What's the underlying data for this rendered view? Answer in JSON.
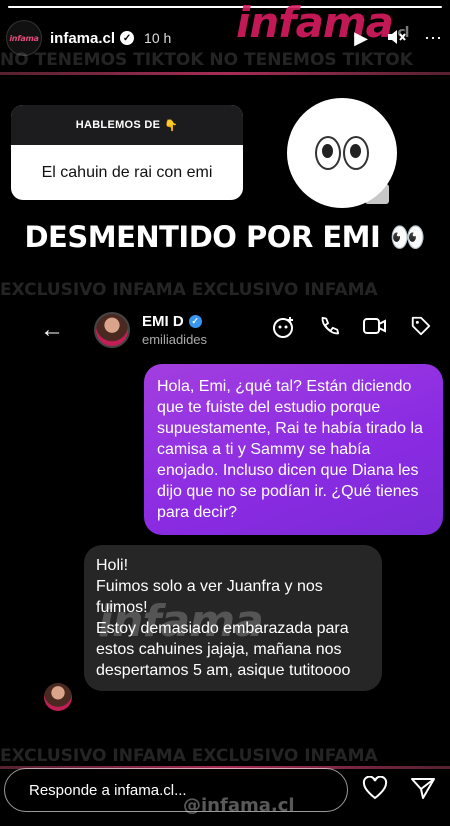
{
  "story": {
    "progress_fraction": 1.0,
    "username": "infama.cl",
    "time": "10 h",
    "avatar_text": "infama",
    "brand_watermark": "infama",
    "brand_suffix": ".cl",
    "banner_top": "NO TENEMOS TIKTOK NO TENEMOS TIKTOK",
    "banner_mid": "EXCLUSIVO INFAMA EXCLUSIVO INFAMA",
    "banner_bottom": "EXCLUSIVO INFAMA EXCLUSIVO INFAMA",
    "handle_watermark": "@infama.cl"
  },
  "question": {
    "title": "HABLEMOS DE",
    "emoji": "👇",
    "answer": "El cahuin de rai con emi"
  },
  "headline": "DESMENTIDO POR EMI 👀",
  "dm": {
    "name": "EMI D",
    "handle": "emiliadides",
    "outgoing": "Hola, Emi, ¿qué tal? Están diciendo que te fuiste del estudio porque supuestamente, Rai te había tirado la camisa a ti y Sammy se había enojado. Incluso dicen que Diana les dijo que no se podían ir. ¿Qué tienes para decir?",
    "incoming": [
      "Holi!",
      "Fuimos solo a ver Juanfra y nos fuimos!",
      "Estoy demasiado embarazada para estos cahuines jajaja, mañana nos despertamos 5 am, asique tutitoooo"
    ]
  },
  "reply": {
    "placeholder": "Responde a infama.cl..."
  },
  "icons": {
    "back": "arrow-left-icon",
    "video_add": "video-effects-icon",
    "phone": "phone-icon",
    "video": "video-camera-icon",
    "tag": "tag-icon",
    "heart": "heart-icon",
    "send": "send-icon",
    "play": "play-icon",
    "mute": "speaker-muted-icon",
    "more": "more-icon"
  }
}
